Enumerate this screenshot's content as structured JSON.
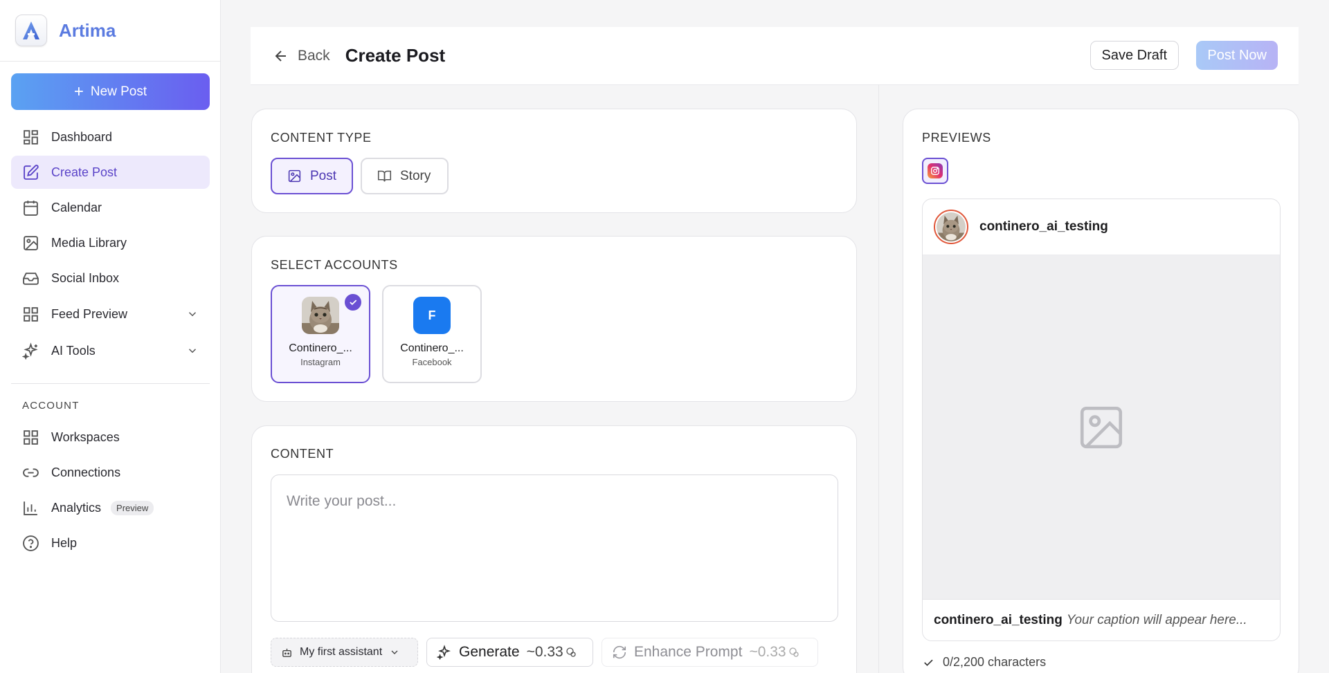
{
  "app": {
    "name": "Artima",
    "logo_letter": "A"
  },
  "sidebar": {
    "new_post_label": "New Post",
    "items": [
      {
        "label": "Dashboard",
        "icon": "grid-icon"
      },
      {
        "label": "Create Post",
        "icon": "edit-icon",
        "active": true
      },
      {
        "label": "Calendar",
        "icon": "calendar-icon"
      },
      {
        "label": "Media Library",
        "icon": "image-icon"
      },
      {
        "label": "Social Inbox",
        "icon": "inbox-icon"
      },
      {
        "label": "Feed Preview",
        "icon": "grid-icon",
        "expandable": true
      },
      {
        "label": "AI Tools",
        "icon": "sparkles-icon",
        "expandable": true
      }
    ],
    "account_section_label": "ACCOUNT",
    "account_items": [
      {
        "label": "Workspaces",
        "icon": "grid-icon"
      },
      {
        "label": "Connections",
        "icon": "link-icon"
      },
      {
        "label": "Analytics",
        "icon": "bar-chart-icon",
        "badge": "Preview"
      },
      {
        "label": "Help",
        "icon": "help-circle-icon"
      }
    ]
  },
  "header": {
    "back_label": "Back",
    "title": "Create Post",
    "save_draft_label": "Save Draft",
    "post_now_label": "Post Now"
  },
  "content_type": {
    "title": "CONTENT TYPE",
    "options": [
      {
        "label": "Post",
        "selected": true
      },
      {
        "label": "Story",
        "selected": false
      }
    ]
  },
  "select_accounts": {
    "title": "SELECT ACCOUNTS",
    "accounts": [
      {
        "name": "Continero_...",
        "platform": "Instagram",
        "selected": true
      },
      {
        "name": "Continero_...",
        "platform": "Facebook",
        "initial": "F",
        "selected": false
      }
    ]
  },
  "content": {
    "title": "CONTENT",
    "placeholder": "Write your post...",
    "value": "",
    "assistant_label": "My first assistant",
    "generate_label": "Generate",
    "generate_cost": "~0.33",
    "enhance_label": "Enhance Prompt",
    "enhance_cost": "~0.33"
  },
  "previews": {
    "title": "PREVIEWS",
    "username": "continero_ai_testing",
    "caption_placeholder": "Your caption will appear here...",
    "char_count": "0/2,200 characters"
  },
  "colors": {
    "accent": "#6a4fd3",
    "brand": "#5b7be0",
    "facebook": "#1a7af0"
  }
}
